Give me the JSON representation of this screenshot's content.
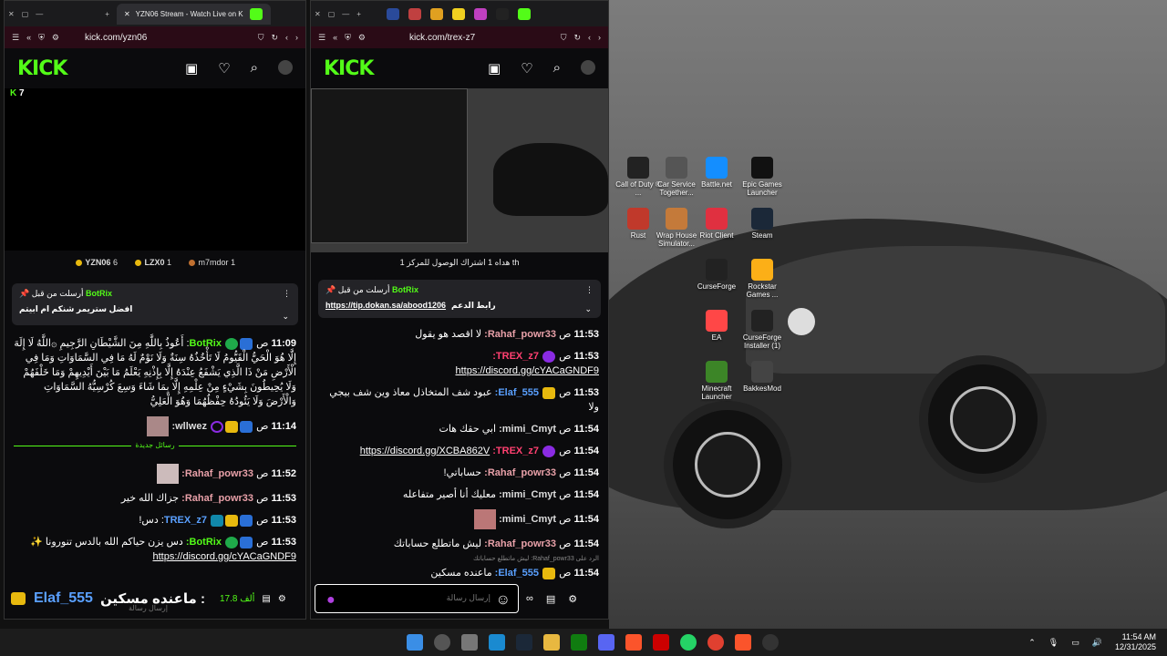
{
  "browser1": {
    "tab_title": "YZN06 Stream - Watch Live on K",
    "url": "kick.com/yzn06",
    "logo": "KICK",
    "viewers": "7",
    "leaderboard": [
      {
        "name": "YZN06",
        "count": "6"
      },
      {
        "name": "LZX0",
        "count": "1"
      },
      {
        "name": "m7mdor",
        "count": "1"
      }
    ],
    "pinned": {
      "sender": "BotRix",
      "header": "أرسلت من قبل",
      "text": "افضل ستريمر شنكم ام ابيتم"
    },
    "messages": [
      {
        "time": "11:09",
        "user": "BotRix",
        "text": "أَعُوذُ بِاللَّهِ مِنَ الشَّيْطَانِ الرَّجِيمِ ۞اللَّهُ لَا إِلَهَ إِلَّا هُوَ الْحَيُّ الْقَيُّومُ لَا تَأْخُذُهُ سِنَةٌ وَلَا نَوْمٌ لَهُ مَا فِي السَّمَاوَاتِ وَمَا فِي الْأَرْضِ مَنْ ذَا الَّذِي يَشْفَعُ عِنْدَهُ إِلَّا بِإِذْنِهِ يَعْلَمُ مَا بَيْنَ أَيْدِيهِمْ وَمَا خَلْفَهُمْ وَلَا يُحِيطُونَ بِشَيْءٍ مِنْ عِلْمِهِ إِلَّا بِمَا شَاءَ وَسِعَ كُرْسِيُّهُ السَّمَاوَاتِ وَالْأَرْضَ وَلَا يَئُودُهُ حِفْظُهُمَا وَهُوَ الْعَلِيُّ"
      },
      {
        "time": "11:14",
        "user": "wllwez:",
        "text": ""
      },
      {
        "time": "11:52",
        "user": "Rahaf_powr33:",
        "text": ""
      },
      {
        "time": "11:53",
        "user": "Rahaf_powr33:",
        "text": "جزاك الله خير"
      },
      {
        "time": "11:53",
        "user": "TREX_z7",
        "text": "دس!"
      },
      {
        "time": "11:53",
        "user": "BotRix:",
        "text": "دس يزن حياكم الله بالدس تنورونا ✨"
      },
      {
        "time": "",
        "user": "",
        "text": "https://discord.gg/cYACaGNDF9"
      }
    ],
    "new_messages": "رسائل جديدة",
    "overlay_user": "Elaf_555",
    "overlay_text": "ماعنده مسكين :",
    "placeholder": "إرسال رسالة",
    "points": "17.8 ألف"
  },
  "browser2": {
    "url": "kick.com/trex-z7",
    "logo": "KICK",
    "goal": "هداه 1 اشتراك الوصول للمركز 1 th",
    "pinned": {
      "sender": "BotRix",
      "header": "أرسلت من قبل",
      "link": "https://tip.dokan.sa/abood1206",
      "text": "رابط الدعم"
    },
    "messages": [
      {
        "time": "11:53",
        "user": "Rahaf_powr33:",
        "text": "لا اقصد هو يقول"
      },
      {
        "time": "11:53",
        "user": "TREX_z7:",
        "text": "https://discord.gg/cYACaGNDF9"
      },
      {
        "time": "11:53",
        "user": "Elaf_555:",
        "text": "عبود شف المتخاذل معاذ وين شف بيجي ولا"
      },
      {
        "time": "11:54",
        "user": "mimi_Cmyt:",
        "text": "ابي حقك هات"
      },
      {
        "time": "11:54",
        "user": "TREX_z7:",
        "text": "https://discord.gg/XCBA862V"
      },
      {
        "time": "11:54",
        "user": "Rahaf_powr33:",
        "text": "حساباتي!"
      },
      {
        "time": "11:54",
        "user": "mimi_Cmyt:",
        "text": "معليك أنا أصير متفاعله"
      },
      {
        "time": "11:54",
        "user": "mimi_Cmyt:",
        "text": ""
      },
      {
        "time": "11:54",
        "user": "Rahaf_powr33:",
        "text": "ليش ماتطلع حساباتك"
      },
      {
        "time": "11:54",
        "user": "Elaf_555:",
        "text": "ماعنده مسكين"
      }
    ],
    "reply_to": "الرد على Rahaf_powr33: ليش ماتطلع حساباتك",
    "placeholder": "إرسال رسالة"
  },
  "desktop_icons": [
    {
      "label": "Call of Duty ® ...",
      "color": "#222"
    },
    {
      "label": "Car Service Together...",
      "color": "#555"
    },
    {
      "label": "Battle.net",
      "color": "#148eff"
    },
    {
      "label": "Epic Games Launcher",
      "color": "#111"
    },
    {
      "label": "Rust",
      "color": "#c0392b"
    },
    {
      "label": "Wrap House Simulator...",
      "color": "#c47a3a"
    },
    {
      "label": "Riot Client",
      "color": "#e03040"
    },
    {
      "label": "Steam",
      "color": "#1b2838"
    },
    {
      "label": "CurseForge",
      "color": "#222"
    },
    {
      "label": "Rockstar Games ...",
      "color": "#fcaf17"
    },
    {
      "label": "EA",
      "color": "#ff4747"
    },
    {
      "label": "CurseForge Installer (1)",
      "color": "#222"
    },
    {
      "label": "Minecraft Launcher",
      "color": "#3c8527"
    },
    {
      "label": "BakkesMod",
      "color": "#444"
    }
  ],
  "clock": {
    "time": "11:54 AM",
    "date": "12/31/2025"
  }
}
